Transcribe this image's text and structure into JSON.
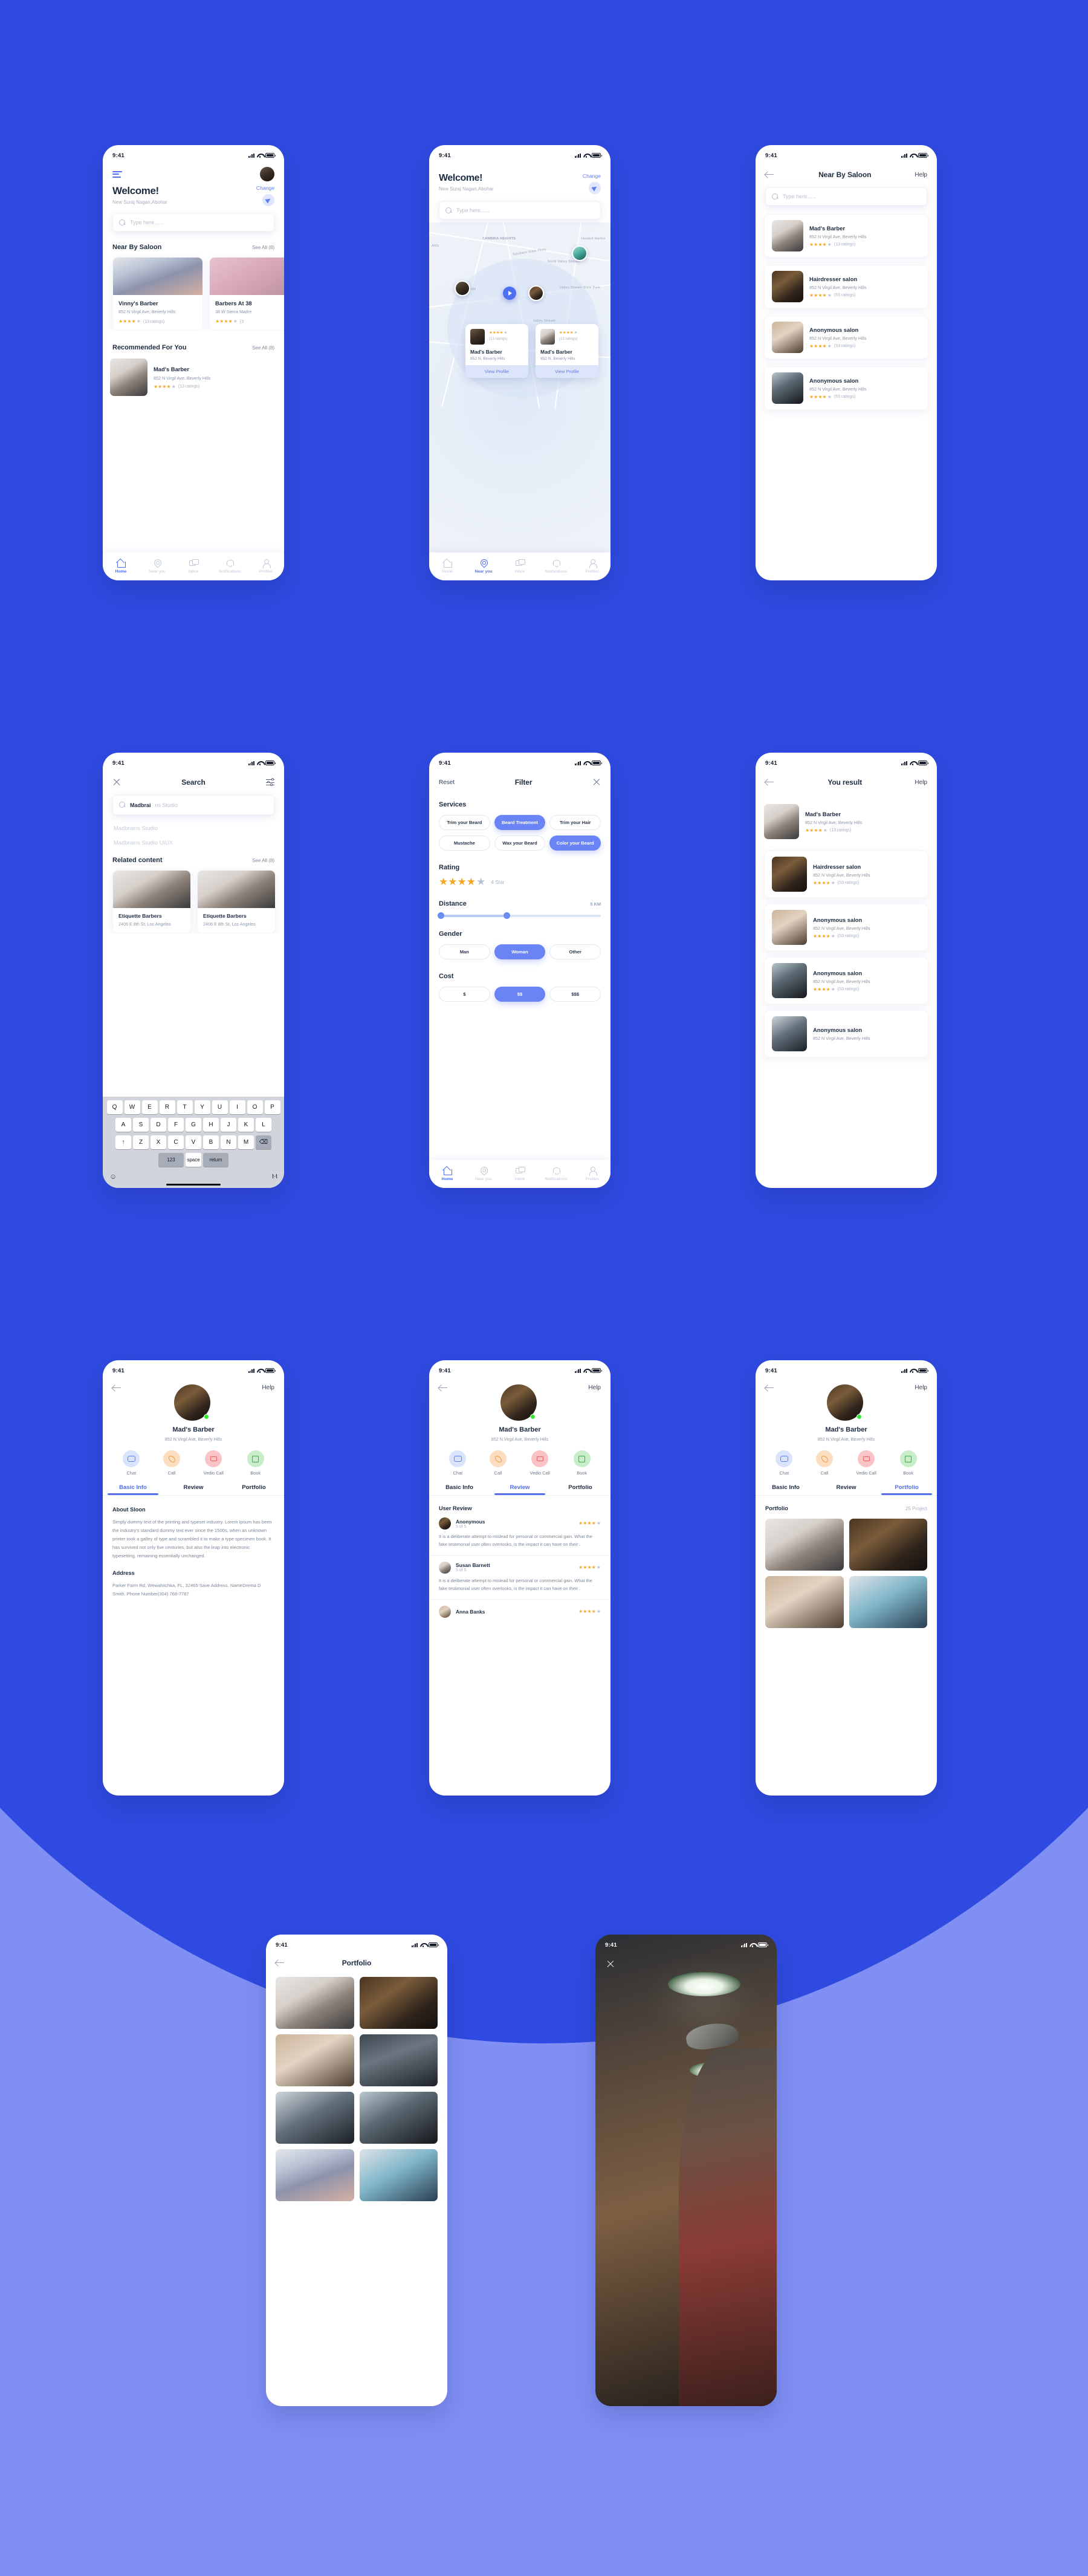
{
  "meta": {
    "status_time": "9:41",
    "accent": "#4f6ef2",
    "accent_soft": "#6b84f5",
    "bg_top": "#2f4ae0",
    "bg_bottom": "#7f8ff4",
    "star_color": "#f5a623"
  },
  "screen_home": {
    "welcome": "Welcome!",
    "location": "New Suraj Nagari,Abohar",
    "change": "Change",
    "search_placeholder": "Type here......",
    "nearby_title": "Near By Saloon",
    "nearby_seeall": "See All (8)",
    "nearby_cards": [
      {
        "name": "Vinny's Barber",
        "addr": "852 N Virgil Ave, Beverly Hills",
        "stars": 4,
        "ratings": "(13 ratings)"
      },
      {
        "name": "Barbers At 38",
        "addr": "38 W Sierra Madre",
        "stars": 4,
        "ratings": "(3"
      }
    ],
    "recommended_title": "Recommended For You",
    "recommended_seeall": "See All (8)",
    "recommended": {
      "name": "Mad's Barber",
      "addr": "852 N Virgil Ave, Beverly Hills",
      "stars": 4,
      "ratings": "(13 ratings)"
    },
    "tabbar": [
      "Home",
      "Near you",
      "Inbox",
      "Notifications",
      "Profiles"
    ]
  },
  "screen_map": {
    "welcome": "Welcome!",
    "location": "New Suraj Nagari,Abohar",
    "change": "Change",
    "search_placeholder": "Type here......",
    "map_labels": [
      "CAMBRIA HEIGHTS",
      "North Valley Stream",
      "Valley Stream State Park",
      "Valley Stream",
      "Southern State Pkwy",
      "ANS",
      "LTON",
      "Hewlett Harbor",
      "Bell Pkwy"
    ],
    "cards": [
      {
        "name": "Mad's Barber",
        "addr": "852 N, Beverly Hills",
        "stars": 4,
        "ratings": "(13 ratings)",
        "cta": "View Profile"
      },
      {
        "name": "Mad's Barber",
        "addr": "852 N, Beverly Hills",
        "stars": 4,
        "ratings": "(13 ratings)",
        "cta": "View Profile"
      }
    ],
    "tabbar": [
      "Home",
      "Near you",
      "Inbox",
      "Notifications",
      "Profiles"
    ]
  },
  "screen_nearby": {
    "title": "Near By Saloon",
    "help": "Help",
    "search_placeholder": "Type here......",
    "rows": [
      {
        "name": "Mad's Barber",
        "addr": "852 N Virgil Ave, Beverly Hills",
        "stars": 4,
        "ratings": "(13 ratings)"
      },
      {
        "name": "Hairdresser salon",
        "addr": "852 N Virgil Ave, Beverly Hills",
        "stars": 4,
        "ratings": "(53 ratings)"
      },
      {
        "name": "Anonymous salon",
        "addr": "852 N Virgil Ave, Beverly Hills",
        "stars": 4,
        "ratings": "(53 ratings)"
      },
      {
        "name": "Anonymous salon",
        "addr": "852 N Virgil Ave, Beverly Hills",
        "stars": 4,
        "ratings": "(53 ratings)"
      }
    ]
  },
  "screen_search": {
    "title": "Search",
    "query_typed": "Madbrai",
    "query_suggest": "ns Studio",
    "suggestions": [
      "Madbrains Studio",
      "Madbrains Studio UIUX"
    ],
    "related_title": "Related content",
    "related_seeall": "See All (8)",
    "related_cards": [
      {
        "name": "Etiquette Barbers",
        "addr": "2406 E 8th St, Los Angeles"
      },
      {
        "name": "Etiquette Barbers",
        "addr": "2406 E 8th St, Los Angeles"
      }
    ],
    "keyboard": {
      "row1": [
        "Q",
        "W",
        "E",
        "R",
        "T",
        "Y",
        "U",
        "I",
        "O",
        "P"
      ],
      "row2": [
        "A",
        "S",
        "D",
        "F",
        "G",
        "H",
        "J",
        "K",
        "L"
      ],
      "row3": [
        "Z",
        "X",
        "C",
        "V",
        "B",
        "N",
        "M"
      ],
      "shift": "↑",
      "backspace": "⌫",
      "numbers": "123",
      "space": "space",
      "return": "return",
      "emoji": "☺",
      "mic": "Ⲙ"
    }
  },
  "screen_filter": {
    "reset": "Reset",
    "title": "Filter",
    "services_title": "Services",
    "services": [
      {
        "label": "Trim your Beard",
        "selected": false
      },
      {
        "label": "Beard Treatment",
        "selected": true
      },
      {
        "label": "Trim your Hair",
        "selected": false
      },
      {
        "label": "Mustache",
        "selected": false
      },
      {
        "label": "Wax your Beard",
        "selected": false
      },
      {
        "label": "Color your Beard",
        "selected": true
      }
    ],
    "rating_title": "Rating",
    "rating_stars": 4,
    "rating_label": "4 Star",
    "distance_title": "Distance",
    "distance_value": "5 KM",
    "gender_title": "Gender",
    "gender": [
      {
        "label": "Man",
        "selected": false
      },
      {
        "label": "Woman",
        "selected": true
      },
      {
        "label": "Other",
        "selected": false
      }
    ],
    "cost_title": "Cost",
    "cost": [
      {
        "label": "$",
        "selected": false
      },
      {
        "label": "$$",
        "selected": true
      },
      {
        "label": "$$$",
        "selected": false
      }
    ],
    "tabbar": [
      "Home",
      "Near you",
      "Inbox",
      "Notifications",
      "Profiles"
    ]
  },
  "screen_result": {
    "title": "You result",
    "help": "Help",
    "rows": [
      {
        "name": "Mad's Barber",
        "addr": "852 N Virgil Ave, Beverly Hills",
        "stars": 4,
        "ratings": "(13 ratings)"
      },
      {
        "name": "Hairdresser salon",
        "addr": "852 N Virgil Ave, Beverly Hills",
        "stars": 4,
        "ratings": "(53 ratings)"
      },
      {
        "name": "Anonymous salon",
        "addr": "852 N Virgil Ave, Beverly Hills",
        "stars": 4,
        "ratings": "(53 ratings)"
      },
      {
        "name": "Anonymous salon",
        "addr": "852 N Virgil Ave, Beverly Hills",
        "stars": 4,
        "ratings": "(53 ratings)"
      },
      {
        "name": "Anonymous salon",
        "addr": "852 N Virgil Ave, Beverly Hills",
        "stars": 4,
        "ratings": "(53 ratings)"
      }
    ]
  },
  "profile": {
    "help": "Help",
    "name": "Mad's Barber",
    "addr": "852 N Virgil Ave, Beverly Hills",
    "actions": [
      "Chat",
      "Call",
      "Vedio Call",
      "Book"
    ],
    "tabs": [
      "Basic Info",
      "Review",
      "Portfolio"
    ]
  },
  "screen_basic": {
    "about_title": "About Sloon",
    "about_text": "Simply dummy text of the printing and typeset industry. Lorem Ipsum has been the industry's standard dummy text ever since the 1500s, when an unknown printer took a galley of type and scrambled it to make a type specimen book. It has survived not only five centuries, but also the leap into electronic typesetting, remaining essentially unchanged.",
    "address_title": "Address",
    "address_text": "Parker Farm Rd, Wewahitchka, FL, 32465 Save Address. NameDrema D Smith. Phone Number(304) 768-7787"
  },
  "screen_review": {
    "heading": "User Review",
    "reviews": [
      {
        "name": "Anonymous",
        "sub": "5 of 5",
        "stars": 4,
        "text": "It is a deliberate attempt to mislead for personal or commercial gain. What the fake testimonial user often overlooks, is the impact it can have on their ."
      },
      {
        "name": "Susan Barnett",
        "sub": "5 of 5",
        "stars": 4,
        "text": "It is a deliberate attempt to mislead for personal or commercial gain. What the fake testimonial user often overlooks, is the impact it can have on their ."
      },
      {
        "name": "Anna Banks",
        "sub": "5 of 5",
        "stars": 4,
        "text": ""
      }
    ]
  },
  "screen_portfolio_tab": {
    "heading": "Portfolio",
    "count": "25 Project"
  },
  "screen_portfolio": {
    "title": "Portfolio"
  },
  "screen_photo": {
    "close": "close-icon"
  }
}
